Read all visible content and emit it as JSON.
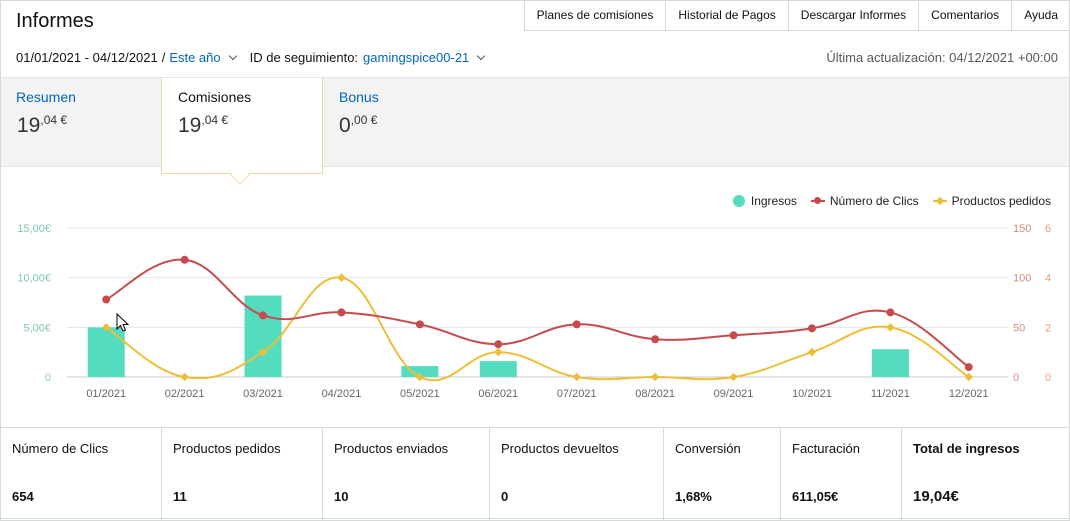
{
  "header": {
    "title": "Informes",
    "nav": [
      "Planes de comisiones",
      "Historial de Pagos",
      "Descargar Informes",
      "Comentarios",
      "Ayuda"
    ],
    "date_range": "01/01/2021 - 04/12/2021",
    "date_separator": "/",
    "period_selector": "Este año",
    "tracking_label": "ID de seguimiento:",
    "tracking_id": "gamingspice00-21",
    "last_updated": "Última actualización: 04/12/2021 +00:00"
  },
  "summary_tabs": [
    {
      "label": "Resumen",
      "value_int": "19",
      "value_dec": ",04 €"
    },
    {
      "label": "Comisiones",
      "value_int": "19",
      "value_dec": ",04 €"
    },
    {
      "label": "Bonus",
      "value_int": "0",
      "value_dec": ",00 €"
    }
  ],
  "legend": {
    "ingresos": "Ingresos",
    "clics": "Número de Clics",
    "productos": "Productos pedidos"
  },
  "chart_data": {
    "type": "bar",
    "categories": [
      "01/2021",
      "02/2021",
      "03/2021",
      "04/2021",
      "05/2021",
      "06/2021",
      "07/2021",
      "08/2021",
      "09/2021",
      "10/2021",
      "11/2021",
      "12/2021"
    ],
    "series": [
      {
        "name": "Ingresos",
        "type": "bar",
        "axis": "left",
        "color": "#54dcbf",
        "values": [
          5.0,
          0,
          8.2,
          0,
          1.1,
          1.6,
          0,
          0,
          0,
          0,
          2.8,
          0
        ]
      },
      {
        "name": "Número de Clics",
        "type": "line",
        "axis": "right1",
        "color": "#c64b4e",
        "values": [
          78,
          118,
          62,
          65,
          53,
          33,
          53,
          38,
          42,
          49,
          65,
          10
        ]
      },
      {
        "name": "Productos pedidos",
        "type": "line",
        "axis": "right2",
        "color": "#edbf37",
        "values": [
          2,
          0,
          1,
          4,
          0,
          1,
          0,
          0,
          0,
          1,
          2,
          0
        ]
      }
    ],
    "y_left": {
      "ticks": [
        "0",
        "5,00€",
        "10,00€",
        "15,00€"
      ],
      "range": [
        0,
        15
      ]
    },
    "y_right1": {
      "ticks": [
        "0",
        "50",
        "100",
        "150"
      ],
      "range": [
        0,
        150
      ]
    },
    "y_right2": {
      "ticks": [
        "0",
        "2",
        "4",
        "6"
      ],
      "range": [
        0,
        6
      ]
    },
    "grid": true,
    "legend_position": "top-right"
  },
  "stats": [
    {
      "label": "Número de Clics",
      "value": "654"
    },
    {
      "label": "Productos pedidos",
      "value": "11"
    },
    {
      "label": "Productos enviados",
      "value": "10"
    },
    {
      "label": "Productos devueltos",
      "value": "0"
    },
    {
      "label": "Conversión",
      "value": "1,68%"
    },
    {
      "label": "Facturación",
      "value": "611,05€"
    },
    {
      "label": "Total de ingresos",
      "value": "19,04€"
    }
  ]
}
